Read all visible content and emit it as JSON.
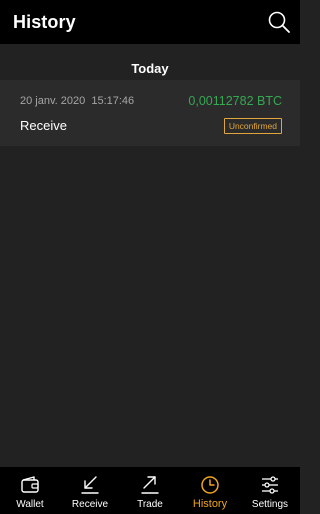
{
  "header": {
    "title": "History",
    "search_icon": "search-icon"
  },
  "section": {
    "title": "Today"
  },
  "transactions": [
    {
      "date": "20 janv. 2020  15:17:46",
      "amount": "0,00112782 BTC",
      "type": "Receive",
      "status": "Unconfirmed"
    }
  ],
  "nav": {
    "active": "History",
    "items": [
      {
        "label": "Wallet",
        "icon": "wallet-icon"
      },
      {
        "label": "Receive",
        "icon": "receive-arrow-icon"
      },
      {
        "label": "Trade",
        "icon": "trade-arrow-icon"
      },
      {
        "label": "History",
        "icon": "clock-icon"
      },
      {
        "label": "Settings",
        "icon": "sliders-icon"
      }
    ]
  },
  "colors": {
    "background": "#222222",
    "header": "#000000",
    "row": "#2b2b2b",
    "amount_green": "#35a852",
    "accent_orange": "#f0a620",
    "status_orange": "#e0a63c"
  }
}
